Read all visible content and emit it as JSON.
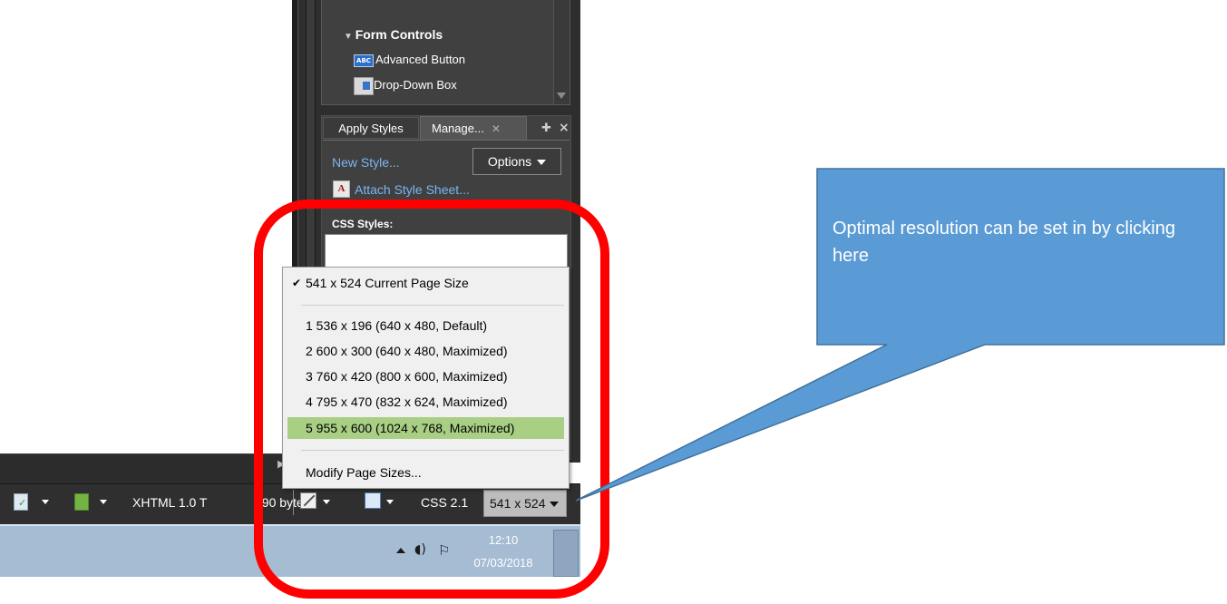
{
  "toolbox": {
    "section_title": "Form Controls",
    "items": [
      {
        "label": "Advanced Button",
        "icon": "abc-button-icon",
        "icon_text": "ABC"
      },
      {
        "label": "Drop-Down Box",
        "icon": "dropdown-box-icon"
      }
    ]
  },
  "styles_panel": {
    "tabs": [
      {
        "label": "Apply Styles",
        "active": false
      },
      {
        "label": "Manage...",
        "active": true,
        "close_glyph": "✕"
      }
    ],
    "new_style_link": "New Style...",
    "options_button": "Options",
    "attach_link": "Attach Style Sheet...",
    "attach_icon_text": "A",
    "css_styles_label": "CSS Styles:"
  },
  "status_bar": {
    "doctype": "XHTML 1.0 T",
    "bytes": "290 bytes",
    "css_version": "CSS 2.1",
    "page_size": "541 x 524"
  },
  "page_size_menu": {
    "current": {
      "label": "541 x 524  Current Page Size",
      "checked": true
    },
    "sizes": [
      {
        "label": "1 536 x 196  (640 x 480, Default)",
        "selected": false
      },
      {
        "label": "2 600 x 300  (640 x 480, Maximized)",
        "selected": false
      },
      {
        "label": "3 760 x 420  (800 x 600, Maximized)",
        "selected": false
      },
      {
        "label": "4 795 x 470  (832 x 624, Maximized)",
        "selected": false
      },
      {
        "label": "5 955 x 600  (1024 x 768, Maximized)",
        "selected": true
      }
    ],
    "modify": "Modify Page Sizes..."
  },
  "taskbar": {
    "time": "12:10",
    "date": "07/03/2018"
  },
  "callout": {
    "text": "Optimal resolution can be set in by clicking here"
  },
  "colors": {
    "callout_fill": "#5b9bd5",
    "callout_border": "#41719c",
    "highlight_ring": "#ff0000",
    "menu_selected": "#a9cf85",
    "link": "#7ab6f0"
  }
}
